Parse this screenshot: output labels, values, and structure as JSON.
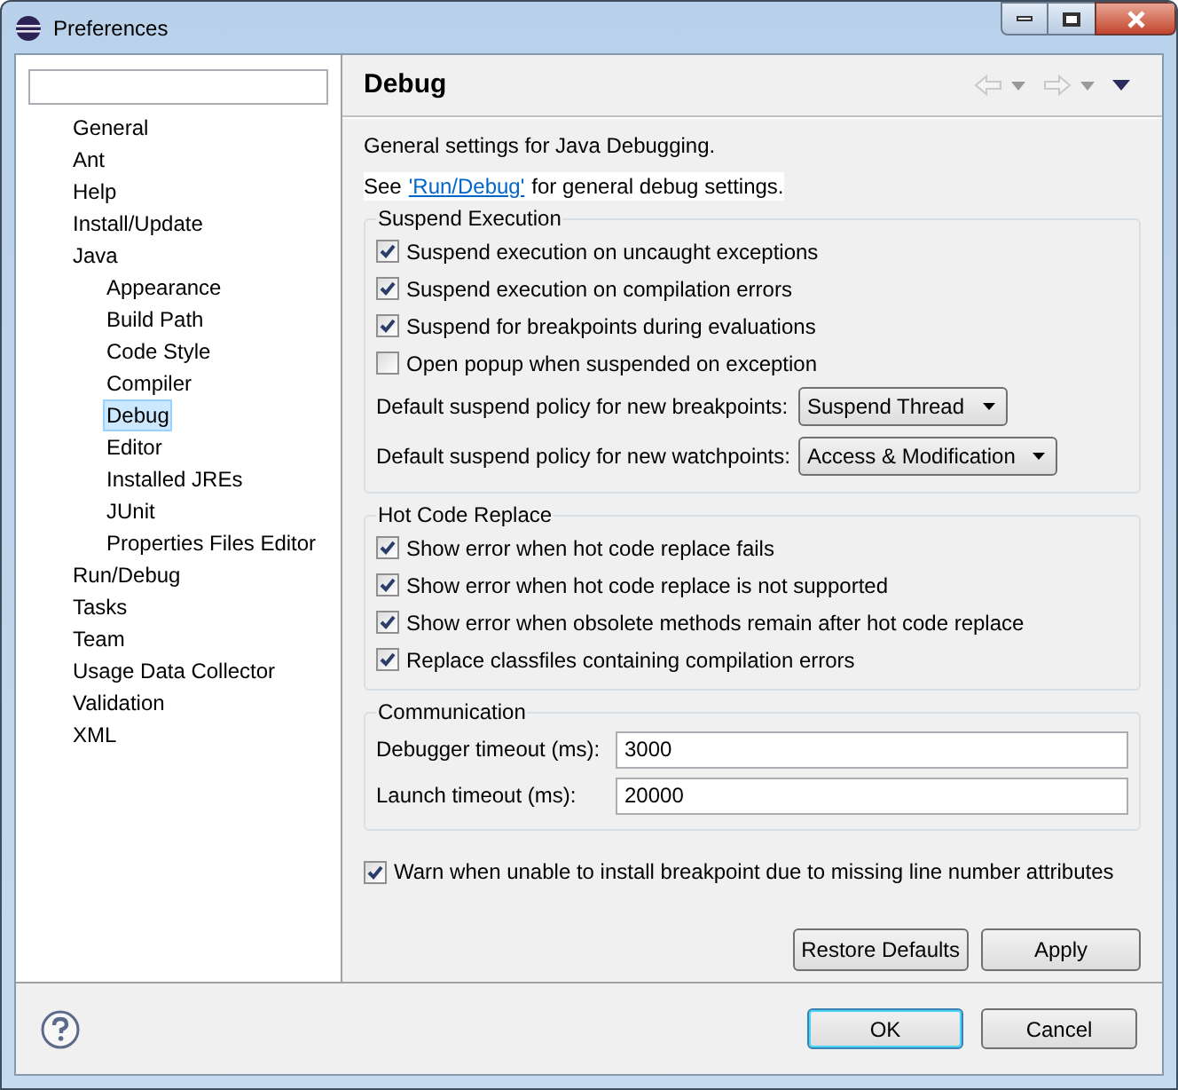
{
  "window": {
    "title": "Preferences"
  },
  "tree": [
    {
      "label": "General",
      "selected": false
    },
    {
      "label": "Ant",
      "selected": false
    },
    {
      "label": "Help",
      "selected": false
    },
    {
      "label": "Install/Update",
      "selected": false
    },
    {
      "label": "Java",
      "selected": false,
      "children": [
        {
          "label": "Appearance",
          "selected": false
        },
        {
          "label": "Build Path",
          "selected": false
        },
        {
          "label": "Code Style",
          "selected": false
        },
        {
          "label": "Compiler",
          "selected": false
        },
        {
          "label": "Debug",
          "selected": true
        },
        {
          "label": "Editor",
          "selected": false
        },
        {
          "label": "Installed JREs",
          "selected": false
        },
        {
          "label": "JUnit",
          "selected": false
        },
        {
          "label": "Properties Files Editor",
          "selected": false
        }
      ]
    },
    {
      "label": "Run/Debug",
      "selected": false
    },
    {
      "label": "Tasks",
      "selected": false
    },
    {
      "label": "Team",
      "selected": false
    },
    {
      "label": "Usage Data Collector",
      "selected": false
    },
    {
      "label": "Validation",
      "selected": false
    },
    {
      "label": "XML",
      "selected": false
    }
  ],
  "page": {
    "title": "Debug",
    "description": "General settings for Java Debugging.",
    "link_prefix": "See",
    "link": "'Run/Debug'",
    "link_suffix": "for general debug settings.",
    "groups": [
      {
        "title": "Suspend Execution",
        "items": [
          {
            "kind": "checkbox",
            "label": "Suspend execution on uncaught exceptions",
            "checked": true
          },
          {
            "kind": "checkbox",
            "label": "Suspend execution on compilation errors",
            "checked": true
          },
          {
            "kind": "checkbox",
            "label": "Suspend for breakpoints during evaluations",
            "checked": true
          },
          {
            "kind": "checkbox",
            "label": "Open popup when suspended on exception",
            "checked": false
          },
          {
            "kind": "combo",
            "label": "Default suspend policy for new breakpoints:",
            "value": "Suspend Thread"
          },
          {
            "kind": "combo",
            "label": "Default suspend policy for new watchpoints:",
            "value": "Access & Modification"
          }
        ]
      },
      {
        "title": "Hot Code Replace",
        "items": [
          {
            "kind": "checkbox",
            "label": "Show error when hot code replace fails",
            "checked": true
          },
          {
            "kind": "checkbox",
            "label": "Show error when hot code replace is not supported",
            "checked": true
          },
          {
            "kind": "checkbox",
            "label": "Show error when obsolete methods remain after hot code replace",
            "checked": true
          },
          {
            "kind": "checkbox",
            "label": "Replace classfiles containing compilation errors",
            "checked": true
          }
        ]
      },
      {
        "title": "Communication",
        "items": [
          {
            "kind": "text",
            "label": "Debugger timeout (ms):",
            "value": "3000"
          },
          {
            "kind": "text",
            "label": "Launch timeout (ms):",
            "value": "20000"
          }
        ]
      }
    ],
    "warn": {
      "label": "Warn when unable to install breakpoint due to missing line number attributes",
      "checked": true
    },
    "page_buttons": [
      "Restore Defaults",
      "Apply"
    ]
  },
  "buttons": [
    {
      "label": "OK",
      "default": true
    },
    {
      "label": "Cancel",
      "default": false
    }
  ]
}
